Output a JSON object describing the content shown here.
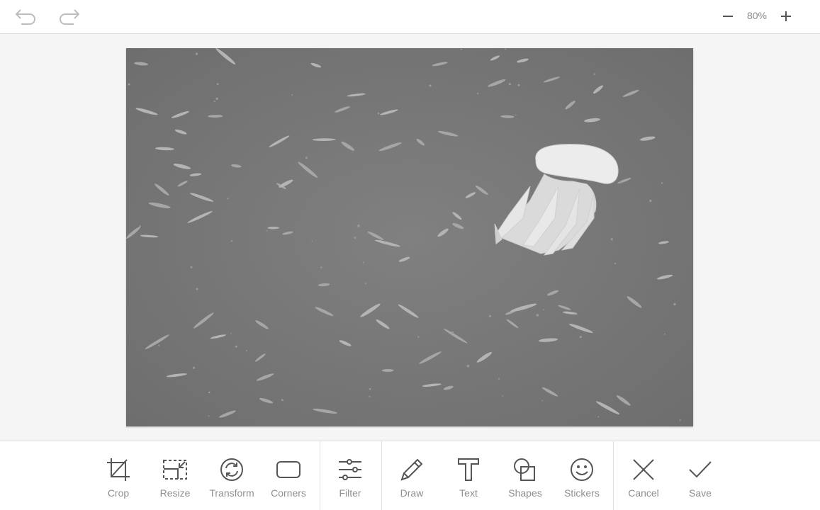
{
  "header": {
    "undo_icon": "undo-arrow-icon",
    "redo_icon": "redo-arrow-icon",
    "zoom_out_icon": "minus-icon",
    "zoom_level": "80%",
    "zoom_in_icon": "plus-icon"
  },
  "canvas": {
    "image_description": "Grayscale underwater photo of a jellyfish among a school of small fish"
  },
  "toolbar": {
    "groups": [
      [
        {
          "label": "Crop",
          "icon": "crop-icon"
        },
        {
          "label": "Resize",
          "icon": "resize-icon"
        },
        {
          "label": "Transform",
          "icon": "rotate-icon"
        },
        {
          "label": "Corners",
          "icon": "rounded-rect-icon"
        }
      ],
      [
        {
          "label": "Filter",
          "icon": "sliders-icon"
        }
      ],
      [
        {
          "label": "Draw",
          "icon": "pencil-icon"
        },
        {
          "label": "Text",
          "icon": "text-icon"
        },
        {
          "label": "Shapes",
          "icon": "shapes-icon"
        },
        {
          "label": "Stickers",
          "icon": "smiley-icon"
        }
      ],
      [
        {
          "label": "Cancel",
          "icon": "close-icon"
        },
        {
          "label": "Save",
          "icon": "check-icon"
        }
      ]
    ]
  },
  "colors": {
    "icon": "#555555",
    "icon_disabled": "#bbbbbb",
    "label": "#8f8f8f",
    "image_bg": "#7b7b7b"
  }
}
